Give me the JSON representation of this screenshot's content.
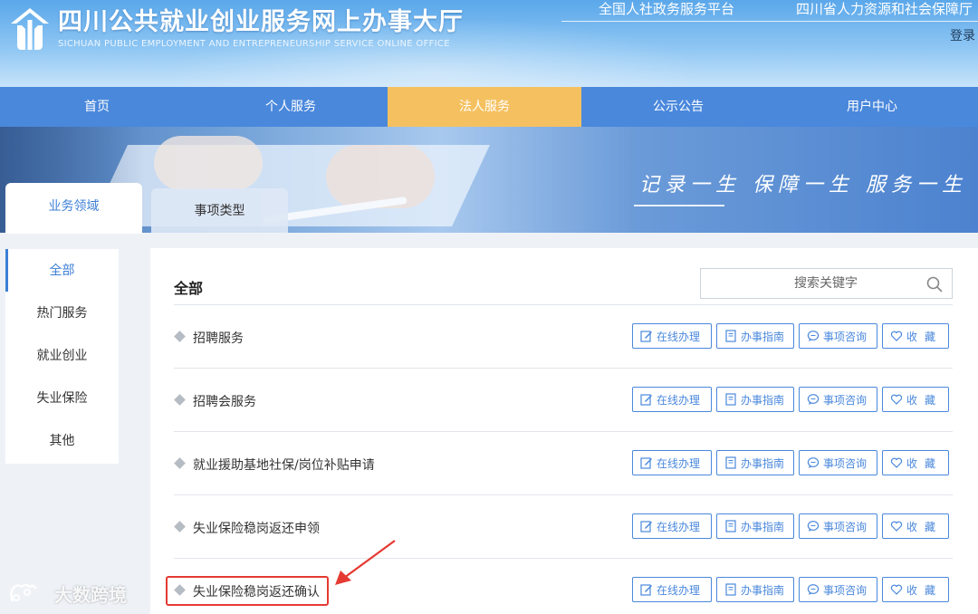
{
  "header": {
    "title": "四川公共就业创业服务网上办事大厅",
    "subtitle": "SICHUAN PUBLIC EMPLOYMENT AND ENTREPRENEURSHIP SERVICE ONLINE OFFICE",
    "top_links": [
      "全国人社政务服务平台",
      "四川省人力资源和社会保障厅"
    ],
    "login": "登录"
  },
  "nav": {
    "items": [
      "首页",
      "个人服务",
      "法人服务",
      "公示公告",
      "用户中心"
    ],
    "active": "法人服务"
  },
  "banner": {
    "slogan": "记录一生  保障一生  服务一生"
  },
  "tabs": {
    "active": "业务领域",
    "inactive": "事项类型"
  },
  "sidebar": {
    "items": [
      "全部",
      "热门服务",
      "就业创业",
      "失业保险",
      "其他"
    ],
    "active": "全部"
  },
  "content": {
    "title": "全部",
    "search_placeholder": "搜索关键字",
    "rows": [
      {
        "label": "招聘服务"
      },
      {
        "label": "招聘会服务"
      },
      {
        "label": "就业援助基地社保/岗位补贴申请"
      },
      {
        "label": "失业保险稳岗返还申领"
      },
      {
        "label": "失业保险稳岗返还确认",
        "highlighted": true
      }
    ],
    "actions": {
      "online": "在线办理",
      "guide": "办事指南",
      "consult": "事项咨询",
      "favorite": "收藏"
    }
  },
  "watermark": "大数跨境",
  "colors": {
    "primary": "#4a88dc",
    "nav_active": "#f5c160",
    "highlight_red": "#e53a32"
  }
}
